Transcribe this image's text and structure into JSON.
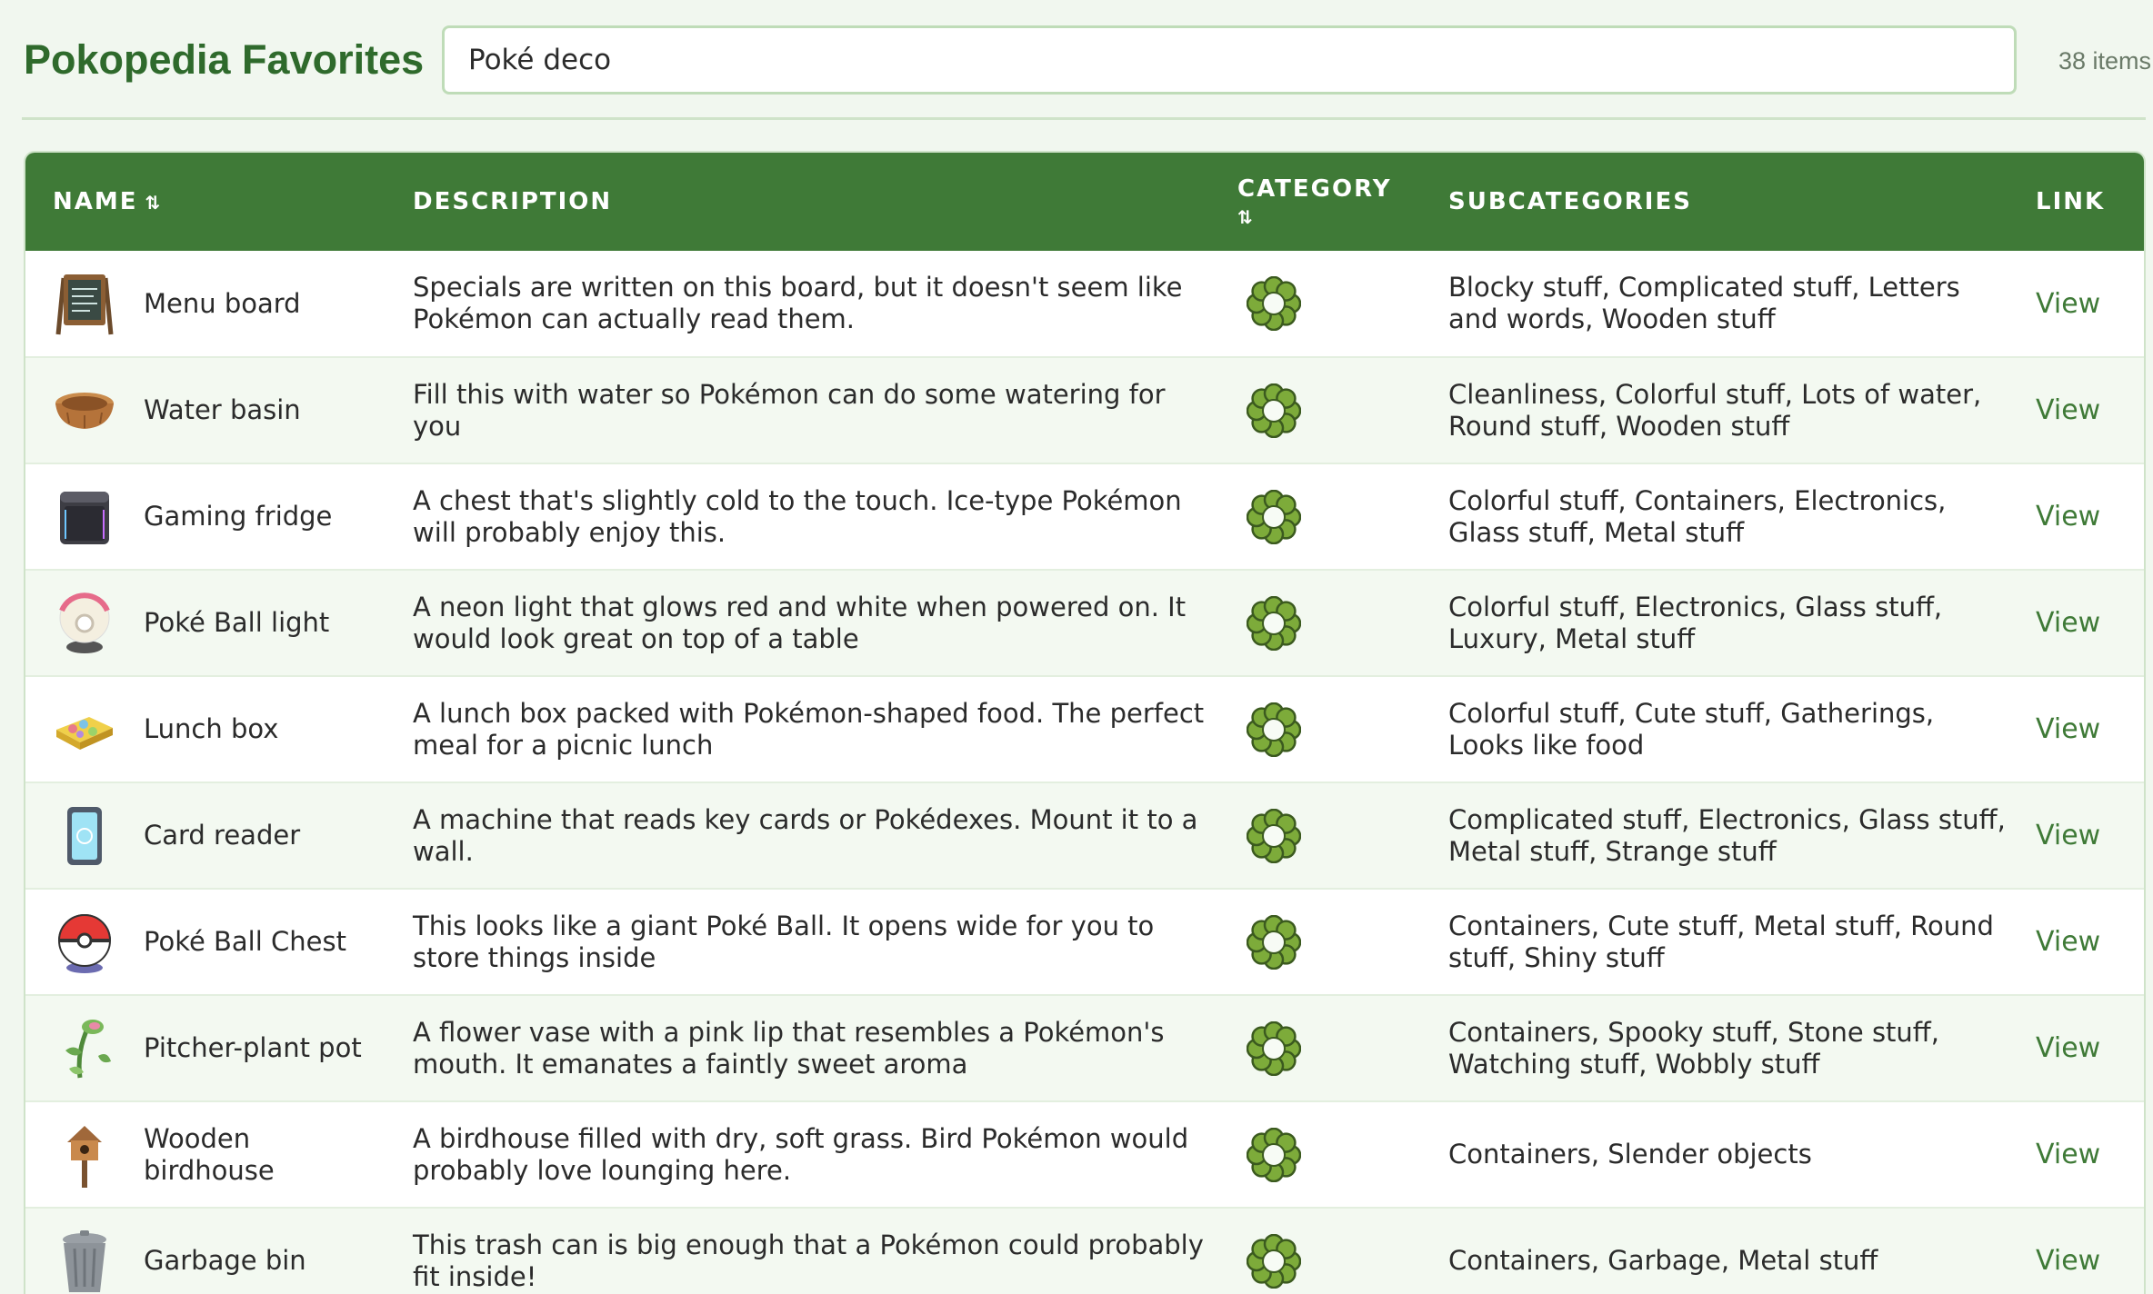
{
  "header": {
    "title": "Pokopedia Favorites",
    "search_value": "Poké deco",
    "item_count": "38 items"
  },
  "table": {
    "columns": {
      "name": "NAME",
      "description": "DESCRIPTION",
      "category": "CATEGORY",
      "subcategories": "SUBCATEGORIES",
      "link": "LINK"
    },
    "sort_glyph": "⇅",
    "rows": [
      {
        "name": "Menu board",
        "description": "Specials are written on this board, but it doesn't seem like Pokémon can actually read them.",
        "subcategories": "Blocky stuff, Complicated stuff, Letters and words, Wooden stuff",
        "link": "View",
        "icon": "menu-board-icon"
      },
      {
        "name": "Water basin",
        "description": "Fill this with water so Pokémon can do some watering for you",
        "subcategories": "Cleanliness, Colorful stuff, Lots of water, Round stuff, Wooden stuff",
        "link": "View",
        "icon": "water-basin-icon"
      },
      {
        "name": "Gaming fridge",
        "description": "A chest that's slightly cold to the touch. Ice-type Pokémon will probably enjoy this.",
        "subcategories": "Colorful stuff, Containers, Electronics, Glass stuff, Metal stuff",
        "link": "View",
        "icon": "gaming-fridge-icon"
      },
      {
        "name": "Poké Ball light",
        "description": "A neon light that glows red and white when powered on. It would look great on top of a table",
        "subcategories": "Colorful stuff, Electronics, Glass stuff, Luxury, Metal stuff",
        "link": "View",
        "icon": "poke-ball-light-icon"
      },
      {
        "name": "Lunch box",
        "description": "A lunch box packed with Pokémon-shaped food. The perfect meal for a picnic lunch",
        "subcategories": "Colorful stuff, Cute stuff, Gatherings, Looks like food",
        "link": "View",
        "icon": "lunch-box-icon"
      },
      {
        "name": "Card reader",
        "description": "A machine that reads key cards or Pokédexes. Mount it to a wall.",
        "subcategories": "Complicated stuff, Electronics, Glass stuff, Metal stuff, Strange stuff",
        "link": "View",
        "icon": "card-reader-icon"
      },
      {
        "name": "Poké Ball Chest",
        "description": "This looks like a giant Poké Ball. It opens wide for you to store things inside",
        "subcategories": "Containers, Cute stuff, Metal stuff, Round stuff, Shiny stuff",
        "link": "View",
        "icon": "poke-ball-chest-icon"
      },
      {
        "name": "Pitcher-plant pot",
        "description": "A flower vase with a pink lip that resembles a Pokémon's mouth. It emanates a faintly sweet aroma",
        "subcategories": "Containers, Spooky stuff, Stone stuff, Watching stuff, Wobbly stuff",
        "link": "View",
        "icon": "pitcher-plant-pot-icon"
      },
      {
        "name": "Wooden birdhouse",
        "description": "A birdhouse filled with dry, soft grass. Bird Pokémon would probably love lounging here.",
        "subcategories": "Containers, Slender objects",
        "link": "View",
        "icon": "wooden-birdhouse-icon"
      },
      {
        "name": "Garbage bin",
        "description": "This trash can is big enough that a Pokémon could probably fit inside!",
        "subcategories": "Containers, Garbage, Metal stuff",
        "link": "View",
        "icon": "garbage-bin-icon"
      }
    ]
  },
  "colors": {
    "accent": "#3f7a37",
    "title": "#2f6a2c",
    "background": "#f1f7ef",
    "row_alt": "#f3f9f1"
  },
  "category_icon": "green-wreath-icon"
}
